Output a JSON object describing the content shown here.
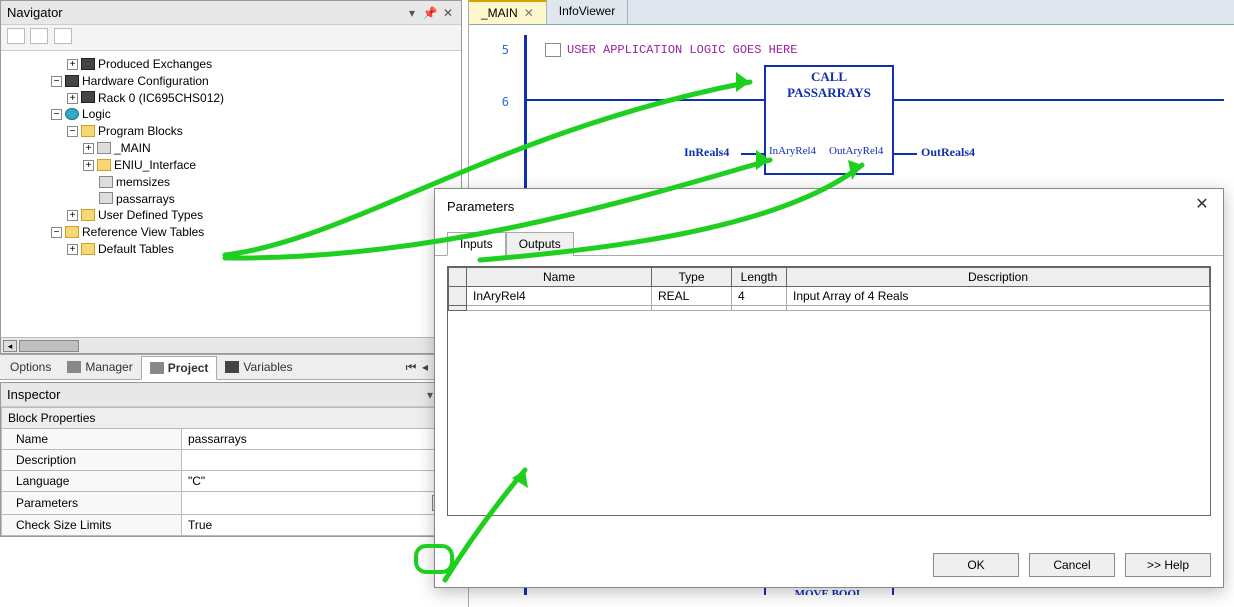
{
  "navigator": {
    "title": "Navigator",
    "tree": {
      "producedExchanges": "Produced Exchanges",
      "hardwareConfig": "Hardware Configuration",
      "rack0": "Rack 0 (IC695CHS012)",
      "logic": "Logic",
      "programBlocks": "Program Blocks",
      "main": "_MAIN",
      "eniu": "ENIU_Interface",
      "memsizes": "memsizes",
      "passarrays": "passarrays",
      "udt": "User Defined Types",
      "refTables": "Reference View Tables",
      "defaultTables": "Default Tables"
    }
  },
  "tabrow": {
    "options": "Options",
    "manager": "Manager",
    "project": "Project",
    "variables": "Variables"
  },
  "inspector": {
    "title": "Inspector",
    "header": "Block Properties",
    "rows": {
      "nameK": "Name",
      "nameV": "passarrays",
      "descK": "Description",
      "descV": "",
      "langK": "Language",
      "langV": "\"C\"",
      "paramK": "Parameters",
      "paramV": "",
      "cslK": "Check Size Limits",
      "cslV": "True"
    }
  },
  "doc": {
    "tabs": {
      "main": "_MAIN",
      "info": "InfoViewer"
    },
    "rung5": "5",
    "rung6": "6",
    "comment": "USER APPLICATION LOGIC GOES HERE",
    "block": {
      "call": "CALL",
      "name": "PASSARRAYS",
      "inExt": "InReals4",
      "inPin": "InAryRel4",
      "outPin": "OutAryRel4",
      "outExt": "OutReals4"
    },
    "moveBool": "MOVE BOOL"
  },
  "dialog": {
    "title": "Parameters",
    "tabs": {
      "inputs": "Inputs",
      "outputs": "Outputs"
    },
    "cols": {
      "name": "Name",
      "type": "Type",
      "len": "Length",
      "desc": "Description"
    },
    "row": {
      "name": "InAryRel4",
      "type": "REAL",
      "len": "4",
      "desc": "Input Array of 4 Reals"
    },
    "btns": {
      "ok": "OK",
      "cancel": "Cancel",
      "help": ">> Help"
    }
  }
}
